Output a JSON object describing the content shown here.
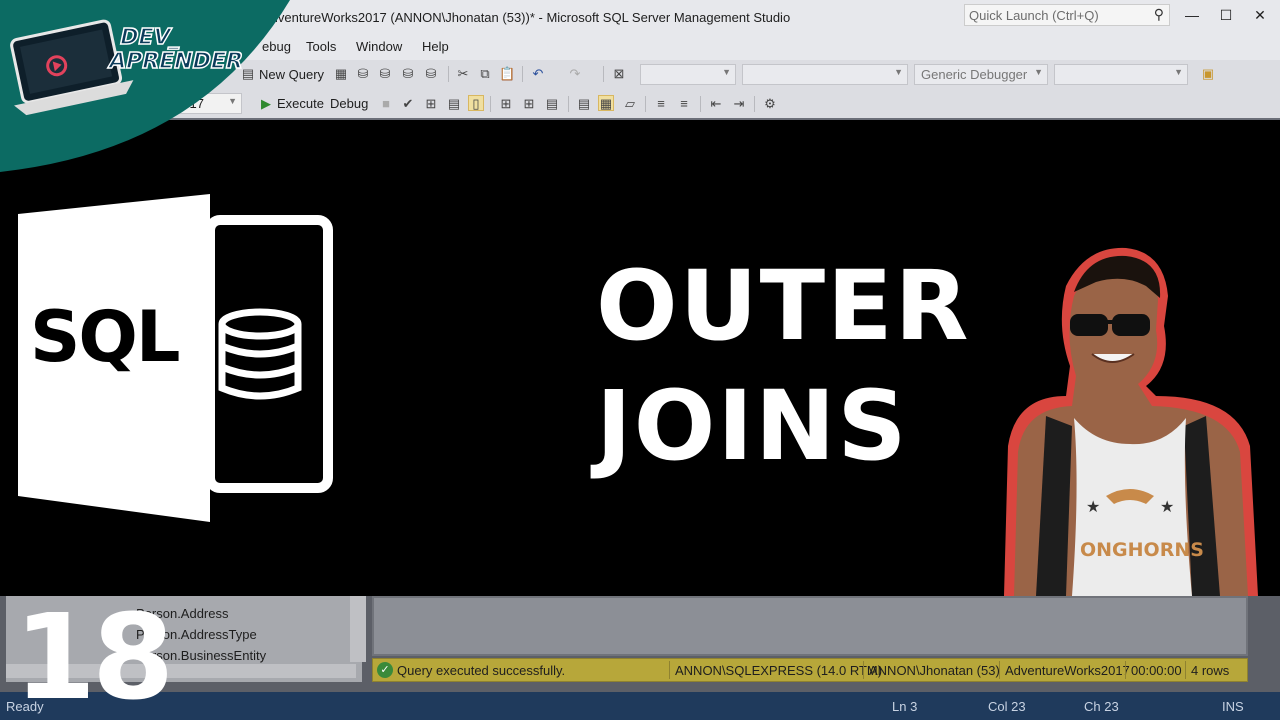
{
  "window": {
    "title": "AdventureWorks2017 (ANNON\\Jhonatan (53))* - Microsoft SQL Server Management Studio",
    "quick_launch_placeholder": "Quick Launch (Ctrl+Q)",
    "minimize": "—",
    "maximize": "☐",
    "close": "✕"
  },
  "logo": {
    "line1": "DEV_",
    "line2": "APRENDER"
  },
  "menu": [
    "ebug",
    "Tools",
    "Window",
    "Help"
  ],
  "toolbar1": {
    "new_query": "New Query",
    "debugger_combo": "Generic Debugger"
  },
  "toolbar2": {
    "database_combo": "2017",
    "execute": "Execute",
    "debug": "Debug"
  },
  "thumbnail": {
    "sql_label": "SQL",
    "headline_line1": "OUTER",
    "headline_line2": "JOINS",
    "episode_number": "18"
  },
  "object_explorer": {
    "rows": [
      "Person.Address",
      "Person.AddressType",
      "Person.BusinessEntity"
    ]
  },
  "query_status": {
    "message": "Query executed successfully.",
    "server": "ANNON\\SQLEXPRESS (14.0 RTM)",
    "user": "ANNON\\Jhonatan (53)",
    "database": "AdventureWorks2017",
    "elapsed": "00:00:00",
    "rows": "4 rows"
  },
  "app_status": {
    "ready": "Ready",
    "ln": "Ln 3",
    "col": "Col 23",
    "ch": "Ch 23",
    "ins": "INS"
  },
  "colors": {
    "teal": "#0c6b63",
    "chrome": "#e7e8ec",
    "status_yellow": "#b7a73a",
    "status_blue": "#1f3a5c",
    "person_outline": "#d9463f"
  }
}
